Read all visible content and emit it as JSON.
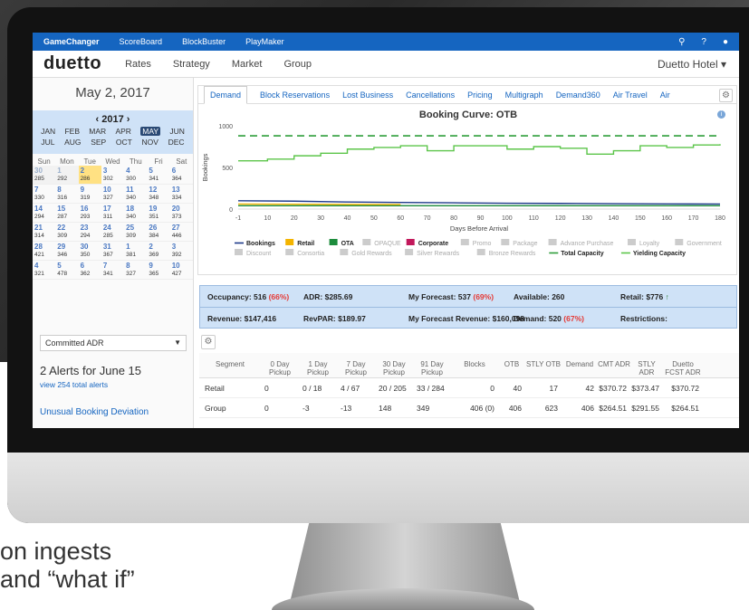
{
  "topbar": {
    "products": [
      "GameChanger",
      "ScoreBoard",
      "BlockBuster",
      "PlayMaker"
    ],
    "icons": [
      "search-icon",
      "help-icon",
      "user-icon"
    ]
  },
  "nav": {
    "logo": "duetto",
    "items": [
      "Rates",
      "Strategy",
      "Market",
      "Group"
    ],
    "hotel": "Duetto Hotel ▾"
  },
  "calendar": {
    "date_title": "May 2, 2017",
    "year": "‹ 2017 ›",
    "months_row1": [
      "JAN",
      "FEB",
      "MAR",
      "APR",
      "MAY",
      "JUN"
    ],
    "months_row2": [
      "JUL",
      "AUG",
      "SEP",
      "OCT",
      "NOV",
      "DEC"
    ],
    "selected_month": "MAY",
    "dow": [
      "Sun",
      "Mon",
      "Tue",
      "Wed",
      "Thu",
      "Fri",
      "Sat"
    ],
    "weeks": [
      [
        [
          "30",
          "285"
        ],
        [
          "1",
          "292"
        ],
        [
          "2",
          "286"
        ],
        [
          "3",
          "302"
        ],
        [
          "4",
          "300"
        ],
        [
          "5",
          "341"
        ],
        [
          "6",
          "364"
        ]
      ],
      [
        [
          "7",
          "330"
        ],
        [
          "8",
          "316"
        ],
        [
          "9",
          "319"
        ],
        [
          "10",
          "327"
        ],
        [
          "11",
          "340"
        ],
        [
          "12",
          "348"
        ],
        [
          "13",
          "334"
        ]
      ],
      [
        [
          "14",
          "294"
        ],
        [
          "15",
          "287"
        ],
        [
          "16",
          "293"
        ],
        [
          "17",
          "311"
        ],
        [
          "18",
          "340"
        ],
        [
          "19",
          "351"
        ],
        [
          "20",
          "373"
        ]
      ],
      [
        [
          "21",
          "314"
        ],
        [
          "22",
          "309"
        ],
        [
          "23",
          "294"
        ],
        [
          "24",
          "285"
        ],
        [
          "25",
          "309"
        ],
        [
          "26",
          "384"
        ],
        [
          "27",
          "446"
        ]
      ],
      [
        [
          "28",
          "421"
        ],
        [
          "29",
          "346"
        ],
        [
          "30",
          "350"
        ],
        [
          "31",
          "367"
        ],
        [
          "1",
          "381"
        ],
        [
          "2",
          "369"
        ],
        [
          "3",
          "392"
        ]
      ],
      [
        [
          "4",
          "321"
        ],
        [
          "5",
          "478"
        ],
        [
          "6",
          "362"
        ],
        [
          "7",
          "341"
        ],
        [
          "8",
          "327"
        ],
        [
          "9",
          "365"
        ],
        [
          "10",
          "427"
        ]
      ]
    ]
  },
  "sidebar": {
    "committed": "Committed ADR",
    "alerts_title": "2 Alerts for June 15",
    "alerts_link": "view 254 total alerts",
    "alert_item": "Unusual Booking Deviation"
  },
  "tabs": [
    "Demand",
    "Block Reservations",
    "Lost Business",
    "Cancellations",
    "Pricing",
    "Multigraph",
    "Demand360",
    "Air Travel",
    "Air"
  ],
  "chart_data": {
    "type": "line",
    "title": "Booking Curve: OTB",
    "xlabel": "Days Before Arrival",
    "ylabel": "Bookings",
    "xlim": [
      -1,
      180
    ],
    "ylim": [
      0,
      1000
    ],
    "x_ticks": [
      "-1",
      "10",
      "20",
      "30",
      "40",
      "50",
      "60",
      "70",
      "80",
      "90",
      "100",
      "110",
      "120",
      "130",
      "140",
      "150",
      "160",
      "170",
      "180"
    ],
    "y_ticks": [
      "0",
      "500",
      "1000"
    ],
    "series": [
      {
        "name": "Total Capacity",
        "color": "#2e9d3a",
        "dashed": true,
        "x": [
          -1,
          180
        ],
        "values": [
          880,
          880
        ]
      },
      {
        "name": "Yielding Capacity",
        "color": "#5cc54a",
        "x": [
          -1,
          10,
          20,
          30,
          40,
          50,
          60,
          70,
          80,
          90,
          100,
          110,
          120,
          130,
          140,
          150,
          160,
          170,
          180
        ],
        "values": [
          580,
          600,
          640,
          670,
          720,
          740,
          760,
          700,
          760,
          760,
          720,
          750,
          730,
          660,
          700,
          760,
          740,
          770,
          780
        ]
      },
      {
        "name": "Bookings",
        "color": "#1e3a8a",
        "x": [
          -1,
          20,
          40,
          60,
          80,
          100,
          120,
          140,
          160,
          180
        ],
        "values": [
          100,
          95,
          85,
          80,
          75,
          70,
          68,
          65,
          62,
          60
        ]
      },
      {
        "name": "OTA",
        "color": "#1c8c3c",
        "x": [
          -1,
          180
        ],
        "values": [
          40,
          40
        ]
      },
      {
        "name": "Retail",
        "color": "#f4b400",
        "x": [
          -1,
          60
        ],
        "values": [
          60,
          55
        ]
      }
    ],
    "legend_row1": [
      "Bookings",
      "Retail",
      "OTA",
      "OPAQUE",
      "Corporate",
      "Promo",
      "Package",
      "Advance Purchase",
      "Loyalty",
      "Government"
    ],
    "legend_row2": [
      "Discount",
      "Consortia",
      "Gold Rewards",
      "Silver Rewards",
      "Bronze Rewards",
      "Total Capacity",
      "Yielding Capacity"
    ],
    "legend_placement": "bottom"
  },
  "metrics": {
    "occupancy": "Occupancy: 516",
    "occupancy_pct": "(66%)",
    "adr": "ADR: $285.69",
    "forecast": "My Forecast: 537",
    "forecast_pct": "(69%)",
    "available": "Available: 260",
    "retail": "Retail: $776",
    "revenue": "Revenue: $147,416",
    "revpar": "RevPAR: $189.97",
    "forecast_rev": "My Forecast Revenue: $160,098",
    "demand": "Demand: 520",
    "demand_pct": "(67%)",
    "restrictions": "Restrictions:"
  },
  "table": {
    "headers": [
      "Segment",
      "0 Day Pickup",
      "1 Day Pickup",
      "7 Day Pickup",
      "30 Day Pickup",
      "91 Day Pickup",
      "Blocks",
      "OTB",
      "STLY OTB",
      "Demand",
      "CMT ADR",
      "STLY ADR",
      "Duetto FCST ADR"
    ],
    "rows": [
      [
        "Retail",
        "0",
        "0 / 18",
        "4 / 67",
        "20 / 205",
        "33 / 284",
        "0",
        "40",
        "17",
        "42",
        "$370.72",
        "$373.47",
        "$370.72"
      ],
      [
        "Group",
        "0",
        "-3",
        "-13",
        "148",
        "349",
        "406 (0)",
        "406",
        "623",
        "406",
        "$264.51",
        "$291.55",
        "$264.51"
      ]
    ]
  },
  "caption": {
    "line1": "on ingests",
    "line2": "and “what if”"
  }
}
